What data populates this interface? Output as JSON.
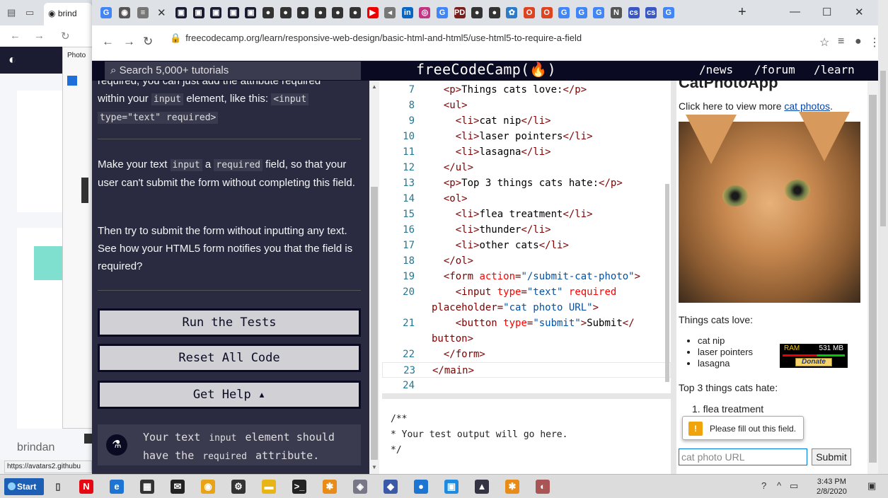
{
  "background_window": {
    "tab_title": "brind",
    "popup_label": "Photo",
    "footer_name": "brindan",
    "status_url": "https://avatars2.githubu"
  },
  "browser": {
    "url": "freecodecamp.org/learn/responsive-web-design/basic-html-and-html5/use-html5-to-require-a-field",
    "tab_favicons": [
      {
        "name": "g-search-tab",
        "glyph": "G",
        "color": "#4285f4"
      },
      {
        "name": "github-tab",
        "glyph": "◉",
        "color": "#555"
      },
      {
        "name": "doc-tab",
        "glyph": "≡",
        "color": "#777"
      },
      {
        "name": "fcc-tab-1",
        "glyph": "▣",
        "color": "#1b1b32"
      },
      {
        "name": "fcc-tab-2",
        "glyph": "▣",
        "color": "#1b1b32"
      },
      {
        "name": "fcc-tab-3",
        "glyph": "▣",
        "color": "#1b1b32"
      },
      {
        "name": "fcc-tab-4",
        "glyph": "▣",
        "color": "#1b1b32"
      },
      {
        "name": "fcc-tab-5",
        "glyph": "▣",
        "color": "#1b1b32"
      },
      {
        "name": "gh-tab-1",
        "glyph": "●",
        "color": "#333"
      },
      {
        "name": "gh-tab-2",
        "glyph": "●",
        "color": "#333"
      },
      {
        "name": "gh-tab-3",
        "glyph": "●",
        "color": "#333"
      },
      {
        "name": "gh-tab-4",
        "glyph": "●",
        "color": "#333"
      },
      {
        "name": "gh-tab-5",
        "glyph": "●",
        "color": "#333"
      },
      {
        "name": "gh-tab-6",
        "glyph": "●",
        "color": "#333"
      },
      {
        "name": "youtube-tab",
        "glyph": "▶",
        "color": "#e00"
      },
      {
        "name": "audio-tab",
        "glyph": "◂",
        "color": "#777"
      },
      {
        "name": "linkedin-tab",
        "glyph": "in",
        "color": "#0a66c2"
      },
      {
        "name": "instagram-tab",
        "glyph": "◎",
        "color": "#c13584"
      },
      {
        "name": "google-tab-1",
        "glyph": "G",
        "color": "#4285f4"
      },
      {
        "name": "pd-tab",
        "glyph": "PD",
        "color": "#7b1d1d"
      },
      {
        "name": "gh-tab-7",
        "glyph": "●",
        "color": "#333"
      },
      {
        "name": "gh-tab-8",
        "glyph": "●",
        "color": "#333"
      },
      {
        "name": "app-tab",
        "glyph": "✿",
        "color": "#2d7ac7"
      },
      {
        "name": "opera-tab-1",
        "glyph": "O",
        "color": "#d42"
      },
      {
        "name": "opera-tab-2",
        "glyph": "O",
        "color": "#d42"
      },
      {
        "name": "google-tab-2",
        "glyph": "G",
        "color": "#4285f4"
      },
      {
        "name": "google-tab-3",
        "glyph": "G",
        "color": "#4285f4"
      },
      {
        "name": "google-tab-4",
        "glyph": "G",
        "color": "#4285f4"
      },
      {
        "name": "n-tab",
        "glyph": "N",
        "color": "#555"
      },
      {
        "name": "cs-tab-1",
        "glyph": "cs",
        "color": "#3a57c4"
      },
      {
        "name": "cs-tab-2",
        "glyph": "cs",
        "color": "#3a57c4"
      },
      {
        "name": "google-tab-5",
        "glyph": "G",
        "color": "#4285f4"
      }
    ]
  },
  "fcc_nav": {
    "search_placeholder": "Search 5,000+ tutorials",
    "brand": "freeCodeCamp(🔥)",
    "links": [
      "/news",
      "/forum",
      "/learn"
    ]
  },
  "instructions": {
    "p1_top": "required, you can just add the attribute required",
    "p1_line2_a": "within your",
    "p1_line2_code": "input",
    "p1_line2_b": "element, like this:",
    "p1_line2_code2": "<input",
    "p1_line3_code": "type=\"text\" required>",
    "p2_a": "Make your text",
    "p2_code1": "input",
    "p2_b": "a",
    "p2_code2": "required",
    "p2_c": "field, so that your user can't submit the form without completing this field.",
    "p3": "Then try to submit the form without inputting any text. See how your HTML5 form notifies you that the field is required?",
    "run_tests": "Run the Tests",
    "reset_code": "Reset All Code",
    "get_help": "Get Help ▴",
    "test_msg_a": "Your text",
    "test_msg_code1": "input",
    "test_msg_b": "element should have the",
    "test_msg_code2": "required",
    "test_msg_c": "attribute."
  },
  "editor": {
    "lines": [
      {
        "n": "7",
        "indent": "  ",
        "html": "<p>Things cats love:</p>"
      },
      {
        "n": "8",
        "indent": "  ",
        "html": "<ul>"
      },
      {
        "n": "9",
        "indent": "    ",
        "html": "<li>cat nip</li>"
      },
      {
        "n": "10",
        "indent": "    ",
        "html": "<li>laser pointers</li>"
      },
      {
        "n": "11",
        "indent": "    ",
        "html": "<li>lasagna</li>"
      },
      {
        "n": "12",
        "indent": "  ",
        "html": "</ul>"
      },
      {
        "n": "13",
        "indent": "  ",
        "html": "<p>Top 3 things cats hate:</p>"
      },
      {
        "n": "14",
        "indent": "  ",
        "html": "<ol>"
      },
      {
        "n": "15",
        "indent": "    ",
        "html": "<li>flea treatment</li>"
      },
      {
        "n": "16",
        "indent": "    ",
        "html": "<li>thunder</li>"
      },
      {
        "n": "17",
        "indent": "    ",
        "html": "<li>other cats</li>"
      },
      {
        "n": "18",
        "indent": "  ",
        "html": "</ol>"
      },
      {
        "n": "19",
        "indent": "  ",
        "html": "<form action=\"/submit-cat-photo\">"
      },
      {
        "n": "20",
        "indent": "    ",
        "html": "<input type=\"text\" required"
      },
      {
        "n": "",
        "indent": "",
        "html": "placeholder=\"cat photo URL\">"
      },
      {
        "n": "21",
        "indent": "    ",
        "html": "<button type=\"submit\">Submit</"
      },
      {
        "n": "",
        "indent": "",
        "html": "button>"
      },
      {
        "n": "22",
        "indent": "  ",
        "html": "</form>"
      },
      {
        "n": "23",
        "indent": "",
        "html": "</main>"
      },
      {
        "n": "24",
        "indent": "",
        "html": ""
      }
    ],
    "output": "/**\n* Your test output will go here.\n*/"
  },
  "preview": {
    "heading": "CatPhotoApp",
    "click_text": "Click here to view more",
    "link_text": "cat photos",
    "link_period": ".",
    "love_heading": "Things cats love:",
    "love_items": [
      "cat nip",
      "laser pointers",
      "lasagna"
    ],
    "hate_heading": "Top 3 things cats hate:",
    "hate_first": "1. flea treatment",
    "tooltip": "Please fill out this field.",
    "input_placeholder": "cat photo URL",
    "submit": "Submit",
    "ram_label": "RAM",
    "ram_value": "531 MB",
    "ram_used_fraction": 0.55,
    "donate": "Donate"
  },
  "taskbar": {
    "start": "Start",
    "time": "3:43 PM",
    "date": "2/8/2020",
    "icons": [
      {
        "name": "netflix-icon",
        "glyph": "N",
        "color": "#e50914"
      },
      {
        "name": "edge-icon",
        "glyph": "e",
        "color": "#1e74d2"
      },
      {
        "name": "store-icon",
        "glyph": "▦",
        "color": "#333"
      },
      {
        "name": "mail-icon",
        "glyph": "✉",
        "color": "#222"
      },
      {
        "name": "chrome-icon",
        "glyph": "◉",
        "color": "#e8a317"
      },
      {
        "name": "settings-icon",
        "glyph": "⚙",
        "color": "#333"
      },
      {
        "name": "explorer-icon",
        "glyph": "▬",
        "color": "#e8b517"
      },
      {
        "name": "terminal-icon",
        "glyph": ">_",
        "color": "#222"
      },
      {
        "name": "slack-icon",
        "glyph": "✱",
        "color": "#e88c17"
      },
      {
        "name": "app-icon-1",
        "glyph": "◈",
        "color": "#778"
      },
      {
        "name": "app-icon-2",
        "glyph": "◆",
        "color": "#3a5aa8"
      },
      {
        "name": "app-icon-3",
        "glyph": "●",
        "color": "#1e74d2"
      },
      {
        "name": "app-icon-4",
        "glyph": "▣",
        "color": "#1e8ae0"
      },
      {
        "name": "photos-icon",
        "glyph": "▲",
        "color": "#334"
      },
      {
        "name": "slack-icon-2",
        "glyph": "✱",
        "color": "#e88c17"
      },
      {
        "name": "app-icon-5",
        "glyph": "◐",
        "color": "#a55"
      }
    ]
  }
}
